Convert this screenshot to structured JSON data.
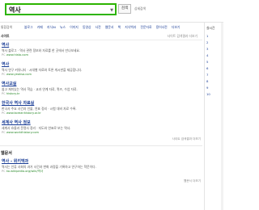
{
  "search": {
    "query": "역사",
    "button": "검색",
    "detail": "상세검색"
  },
  "tabs": {
    "label": "통합검색",
    "items": [
      "블로그",
      "카페",
      "지식iN",
      "뉴스",
      "이미지",
      "동영상",
      "사전",
      "웹문서",
      "책",
      "지식백과",
      "전문자료",
      "용어사전",
      "더보기"
    ]
  },
  "section1": {
    "title": "사이트",
    "more": "사이트 검색결과 더보기"
  },
  "results": [
    {
      "title": "역사",
      "desc": "역사 블로그 · 역사 관련 정보와 자료를 한 곳에서 만나보세요.",
      "url": "www.histo.com",
      "pc": "PC"
    },
    {
      "title": "역사",
      "desc": "역사 연구 커뮤니티 · 시대별 자료와 토론 게시판을 제공합니다.",
      "url": "www.yeoksa.com",
      "pc": "PC"
    },
    {
      "title": "역사교실",
      "desc": "쉽고 재미있는 역사 학습 · 교과 연계 자료, 퀴즈, 수업 자료.",
      "url": "history.kr",
      "pc": "PC"
    },
    {
      "title": "한국사 역사 자료실",
      "desc": "한국사 주요 사건과 인물, 연표 정리 · 시험 대비 자료 수록.",
      "url": "www.koreanhistory.or.kr",
      "pc": "PC"
    },
    {
      "title": "세계사 역사 정보",
      "desc": "세계사 흐름과 문명사 정리 · 지도와 연표로 보는 역사.",
      "url": "www.worldhistory.com",
      "pc": "PC"
    }
  ],
  "section2": {
    "title": "웹문서",
    "more": "웹문서 더보기"
  },
  "webdocs": [
    {
      "title": "역사 - 위키백과",
      "desc": "역사는 인류 사회의 과거 사건과 변화 과정을 기록하고 연구하는 학문이다.",
      "url": "ko.wikipedia.org/wiki/역사",
      "pc": "PC"
    }
  ],
  "rightcol": [
    "실시간",
    "1",
    "2",
    "3",
    "4",
    "5",
    "6",
    "7",
    "8",
    "9",
    "10"
  ]
}
